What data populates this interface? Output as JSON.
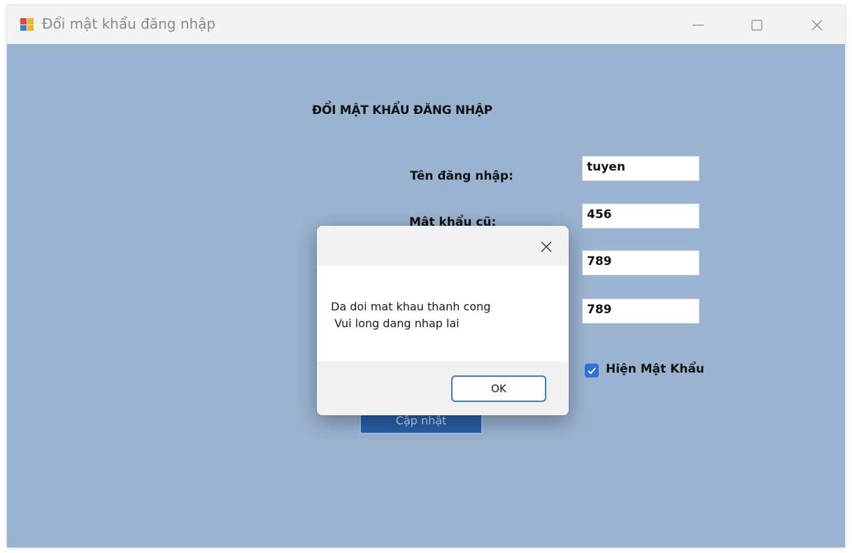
{
  "window": {
    "title": "Đổi mật khẩu đăng nhập",
    "controls": [
      "minimize-icon",
      "maximize-icon",
      "close-icon"
    ]
  },
  "form": {
    "heading": "ĐỔI MẬT KHẨU ĐĂNG NHẬP",
    "username_label": "Tên đăng nhập:",
    "old_password_label": "Mật khẩu cũ:",
    "username_value": "tuyen",
    "old_password_value": "456",
    "new_password_value": "789",
    "confirm_password_value": "789",
    "show_password_label": "Hiện Mật Khẩu",
    "show_password_checked": true,
    "update_button": "Cập nhật"
  },
  "dialog": {
    "message_line1": "Da doi mat khau thanh cong",
    "message_line2": " Vui long dang nhap lai",
    "ok_button": "OK",
    "close_icon": "close-icon"
  },
  "colors": {
    "window_background": "#9ab3d0",
    "titlebar": "#f3f3f3",
    "accent": "#2f74d6",
    "update_button": "#2a5fa8"
  }
}
